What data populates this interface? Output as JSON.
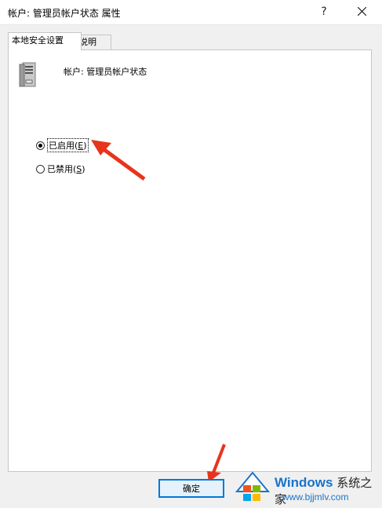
{
  "window": {
    "title": "帐户: 管理员帐户状态 属性",
    "help_glyph": "?"
  },
  "tabs": [
    {
      "label": "本地安全设置",
      "active": true
    },
    {
      "label": "说明",
      "active": false
    }
  ],
  "panel": {
    "heading": "帐户: 管理员帐户状态",
    "options": [
      {
        "label": "已启用(",
        "key": "E",
        "suffix": ")",
        "selected": true
      },
      {
        "label": "已禁用(",
        "key": "S",
        "suffix": ")",
        "selected": false
      }
    ]
  },
  "buttons": {
    "ok_label": "确定"
  },
  "watermark": {
    "brand": "Windows",
    "brand_cn": "系统之家",
    "url": "www.bjjmlv.com"
  },
  "colors": {
    "accent": "#0078d7",
    "arrow": "#e8341c"
  }
}
